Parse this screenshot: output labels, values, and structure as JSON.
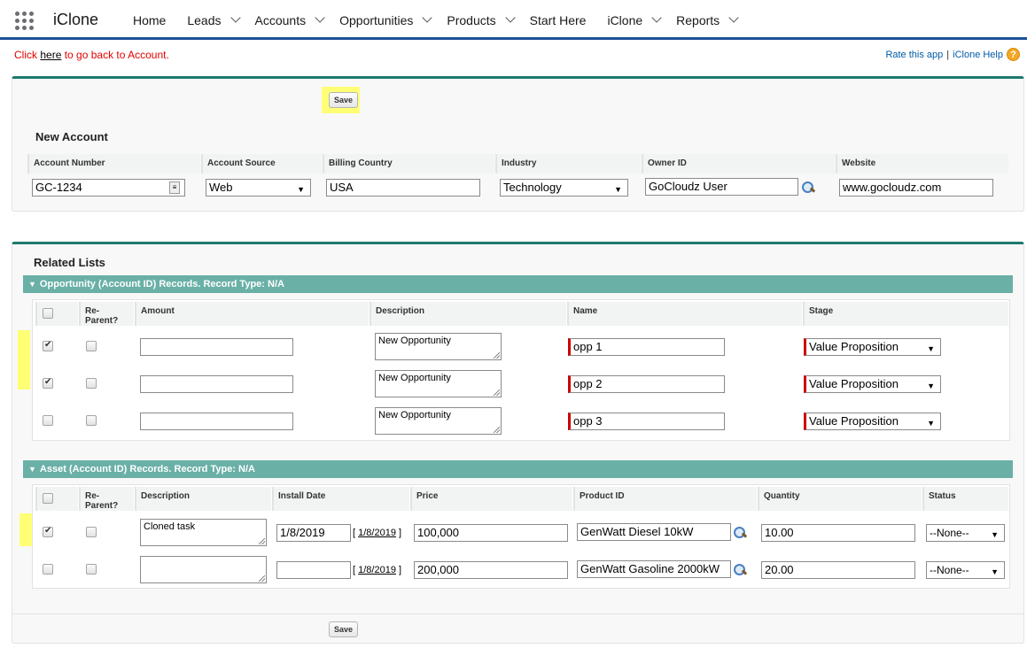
{
  "nav": {
    "app_name": "iClone",
    "items": [
      {
        "label": "Home",
        "chevron": false
      },
      {
        "label": "Leads",
        "chevron": true
      },
      {
        "label": "Accounts",
        "chevron": true
      },
      {
        "label": "Opportunities",
        "chevron": true
      },
      {
        "label": "Products",
        "chevron": true
      },
      {
        "label": "Start Here",
        "chevron": false
      },
      {
        "label": "iClone",
        "chevron": true
      },
      {
        "label": "Reports",
        "chevron": true
      }
    ]
  },
  "header": {
    "back_prefix": "Click ",
    "back_link": "here",
    "back_suffix": " to go back to Account.",
    "rate_link": "Rate this app",
    "separator": "|",
    "help_link": "iClone Help",
    "help_icon_glyph": "?"
  },
  "account": {
    "save_label": "Save",
    "title": "New Account",
    "columns": [
      "Account Number",
      "Account Source",
      "Billing Country",
      "Industry",
      "Owner ID",
      "Website"
    ],
    "values": {
      "account_number": "GC-1234",
      "account_source": "Web",
      "billing_country": "USA",
      "industry": "Technology",
      "owner_id": "GoCloudz User",
      "website": "www.gocloudz.com"
    }
  },
  "related": {
    "title": "Related Lists",
    "opportunity": {
      "bar_title": "Opportunity (Account ID) Records. Record Type: N/A",
      "columns": [
        "Re-Parent?",
        "Amount",
        "Description",
        "Name",
        "Stage"
      ],
      "rows": [
        {
          "checked": true,
          "description": "New Opportunity",
          "name": "opp 1",
          "stage": "Value Proposition"
        },
        {
          "checked": true,
          "description": "New Opportunity",
          "name": "opp 2",
          "stage": "Value Proposition"
        },
        {
          "checked": false,
          "description": "New Opportunity",
          "name": "opp 3",
          "stage": "Value Proposition"
        }
      ]
    },
    "asset": {
      "bar_title": "Asset (Account ID) Records. Record Type: N/A",
      "columns": [
        "Re-Parent?",
        "Description",
        "Install Date",
        "Price",
        "Product ID",
        "Quantity",
        "Status"
      ],
      "rows": [
        {
          "checked": true,
          "description": "Cloned task",
          "install_date": "1/8/2019",
          "today_link": "1/8/2019",
          "price": "100,000",
          "product": "GenWatt Diesel 10kW",
          "quantity": "10.00",
          "status": "--None--"
        },
        {
          "checked": false,
          "description": "",
          "install_date": "",
          "today_link": "1/8/2019",
          "price": "200,000",
          "product": "GenWatt Gasoline 2000kW",
          "quantity": "20.00",
          "status": "--None--"
        }
      ]
    },
    "save_label": "Save"
  },
  "colors": {
    "nav_border": "#1b5297",
    "panel_border": "#1e7a6b",
    "section_bar": "#6ab0a7",
    "required": "#cc0000",
    "highlight": "#ffff66",
    "link_red": "#e20000"
  }
}
